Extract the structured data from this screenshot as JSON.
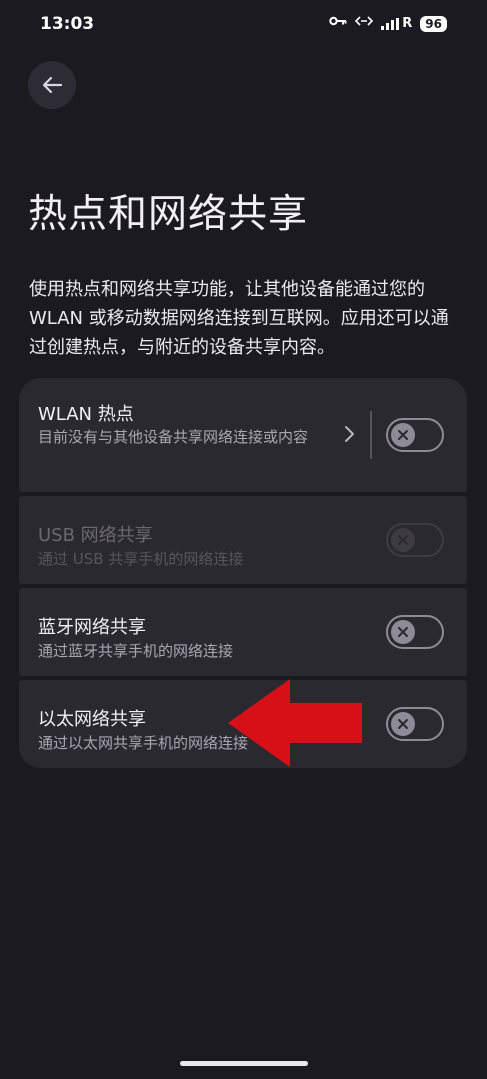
{
  "status_bar": {
    "time": "13:03",
    "icons": [
      "key-icon",
      "data-transfer-icon",
      "signal-icon"
    ],
    "signal_text": "R",
    "battery": "96"
  },
  "header": {
    "back_icon": "arrow-left-icon",
    "title": "热点和网络共享"
  },
  "description": "使用热点和网络共享功能，让其他设备能通过您的 WLAN 或移动数据网络连接到互联网。应用还可以通过创建热点，与附近的设备共享内容。",
  "settings": [
    {
      "title": "WLAN 热点",
      "subtitle": "目前没有与其他设备共享网络连接或内容",
      "enabled": true,
      "on": false
    },
    {
      "title": "USB 网络共享",
      "subtitle": "通过 USB 共享手机的网络连接",
      "enabled": false,
      "on": false
    },
    {
      "title": "蓝牙网络共享",
      "subtitle": "通过蓝牙共享手机的网络连接",
      "enabled": true,
      "on": false
    },
    {
      "title": "以太网络共享",
      "subtitle": "通过以太网共享手机的网络连接",
      "enabled": true,
      "on": false
    }
  ],
  "colors": {
    "background": "#1c1a21",
    "card": "#2b2930",
    "annotation_arrow": "#d70f17"
  }
}
